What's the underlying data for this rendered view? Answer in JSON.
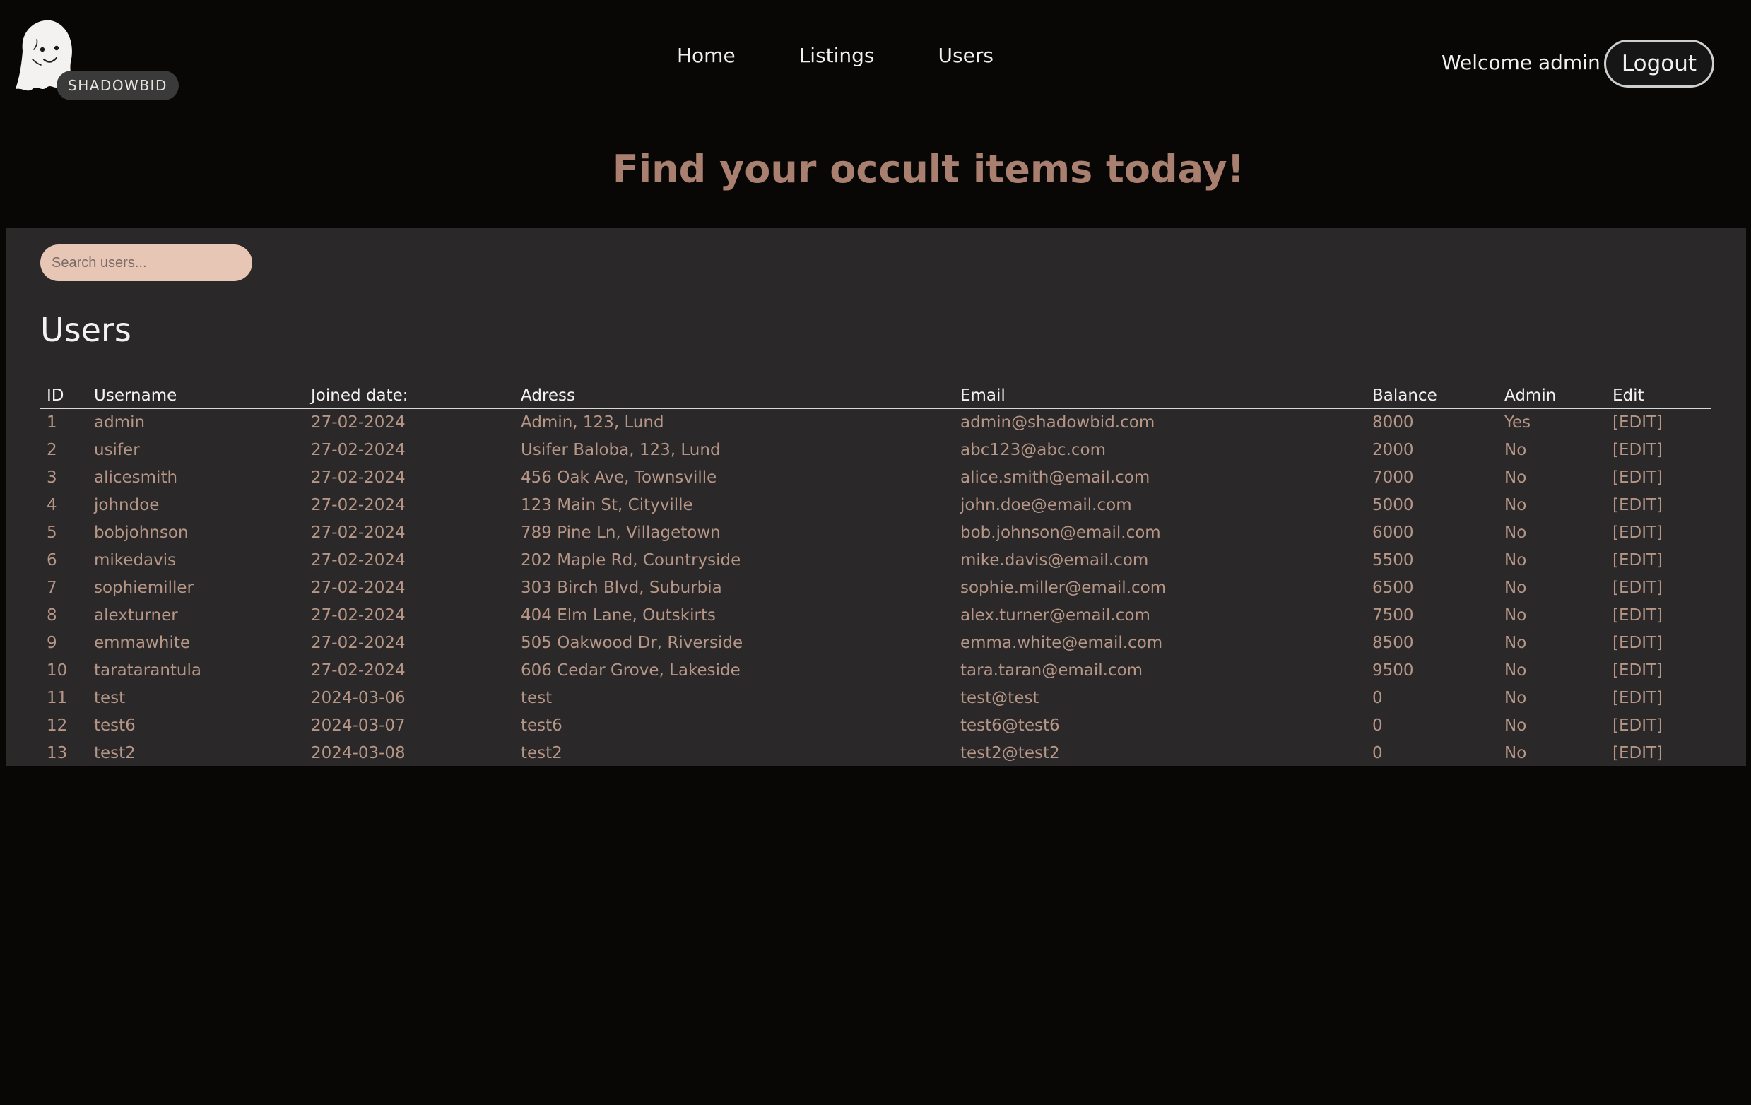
{
  "brand": {
    "name": "SHADOWBID",
    "logo_icon": "ghost-icon"
  },
  "nav": {
    "items": [
      "Home",
      "Listings",
      "Users"
    ]
  },
  "user": {
    "welcome": "Welcome admin !",
    "logout_label": "Logout"
  },
  "hero": {
    "title": "Find your occult items today!"
  },
  "search": {
    "placeholder": "Search users...",
    "value": ""
  },
  "users_section": {
    "title": "Users",
    "columns": [
      "ID",
      "Username",
      "Joined date:",
      "Adress",
      "Email",
      "Balance",
      "Admin",
      "Edit"
    ],
    "rows": [
      [
        "1",
        "admin",
        "27-02-2024",
        "Admin, 123, Lund",
        "admin@shadowbid.com",
        "8000",
        "Yes",
        "[EDIT]"
      ],
      [
        "2",
        "usifer",
        "27-02-2024",
        "Usifer Baloba, 123, Lund",
        "abc123@abc.com",
        "2000",
        "No",
        "[EDIT]"
      ],
      [
        "3",
        "alicesmith",
        "27-02-2024",
        "456 Oak Ave, Townsville",
        "alice.smith@email.com",
        "7000",
        "No",
        "[EDIT]"
      ],
      [
        "4",
        "johndoe",
        "27-02-2024",
        "123 Main St, Cityville",
        "john.doe@email.com",
        "5000",
        "No",
        "[EDIT]"
      ],
      [
        "5",
        "bobjohnson",
        "27-02-2024",
        "789 Pine Ln, Villagetown",
        "bob.johnson@email.com",
        "6000",
        "No",
        "[EDIT]"
      ],
      [
        "6",
        "mikedavis",
        "27-02-2024",
        "202 Maple Rd, Countryside",
        "mike.davis@email.com",
        "5500",
        "No",
        "[EDIT]"
      ],
      [
        "7",
        "sophiemiller",
        "27-02-2024",
        "303 Birch Blvd, Suburbia",
        "sophie.miller@email.com",
        "6500",
        "No",
        "[EDIT]"
      ],
      [
        "8",
        "alexturner",
        "27-02-2024",
        "404 Elm Lane, Outskirts",
        "alex.turner@email.com",
        "7500",
        "No",
        "[EDIT]"
      ],
      [
        "9",
        "emmawhite",
        "27-02-2024",
        "505 Oakwood Dr, Riverside",
        "emma.white@email.com",
        "8500",
        "No",
        "[EDIT]"
      ],
      [
        "10",
        "taratarantula",
        "27-02-2024",
        "606 Cedar Grove, Lakeside",
        "tara.taran@email.com",
        "9500",
        "No",
        "[EDIT]"
      ],
      [
        "11",
        "test",
        "2024-03-06",
        "test",
        "test@test",
        "0",
        "No",
        "[EDIT]"
      ],
      [
        "12",
        "test6",
        "2024-03-07",
        "test6",
        "test6@test6",
        "0",
        "No",
        "[EDIT]"
      ],
      [
        "13",
        "test2",
        "2024-03-08",
        "test2",
        "test2@test2",
        "0",
        "No",
        "[EDIT]"
      ]
    ]
  },
  "colors": {
    "background": "#080706",
    "panel": "#2a2829",
    "accent_title": "#a98070",
    "cell_text": "#b69686",
    "search_fill": "#e8c6b6"
  }
}
